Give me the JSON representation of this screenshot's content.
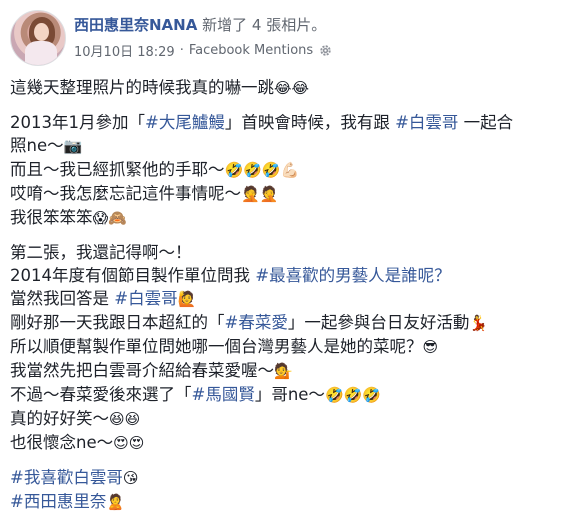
{
  "post": {
    "page_name": "西田惠里奈NANA",
    "action": "新增了 4 張相片。",
    "date": "10月10日 18:29",
    "separator": "·",
    "app": "Facebook Mentions",
    "privacy_icon": "gear-icon"
  },
  "paragraphs": [
    {
      "lines": [
        [
          {
            "t": "這幾天整理照片的時候我真的嚇一跳"
          },
          {
            "t": "😂😂",
            "e": true
          }
        ]
      ]
    },
    {
      "lines": [
        [
          {
            "t": "2013年1月參加「"
          },
          {
            "t": "#大尾鱸鰻",
            "h": true
          },
          {
            "t": "」首映會時候，我有跟 "
          },
          {
            "t": "#白雲哥",
            "h": true
          },
          {
            "t": " 一起合"
          }
        ],
        [
          {
            "t": "照ne～"
          },
          {
            "t": "📷",
            "e": true
          }
        ],
        [
          {
            "t": "而且～我已經抓緊他的手耶～"
          },
          {
            "t": "🤣🤣🤣💪🏻",
            "e": true
          }
        ],
        [
          {
            "t": "哎唷～我怎麼忘記這件事情呢～"
          },
          {
            "t": "🤦🤦",
            "e": true
          }
        ],
        [
          {
            "t": "我很笨笨笨"
          },
          {
            "t": "😱🙈",
            "e": true
          }
        ]
      ]
    },
    {
      "lines": [
        [
          {
            "t": "第二張，我還記得啊～！"
          }
        ],
        [
          {
            "t": "2014年度有個節目製作單位問我 "
          },
          {
            "t": "#最喜歡的男藝人是誰呢？",
            "h": true
          }
        ],
        [
          {
            "t": "當然我回答是 "
          },
          {
            "t": "#白雲哥",
            "h": true
          },
          {
            "t": "🙋",
            "e": true
          }
        ],
        [
          {
            "t": "剛好那一天我跟日本超紅的「"
          },
          {
            "t": "#春菜愛",
            "h": true
          },
          {
            "t": "」一起參與台日友好活動"
          },
          {
            "t": "💃",
            "e": true
          }
        ],
        [
          {
            "t": "所以順便幫製作單位問她哪一個台灣男藝人是她的菜呢？"
          },
          {
            "t": "😎",
            "e": true
          }
        ],
        [
          {
            "t": "我當然先把白雲哥介紹給春菜愛喔～"
          },
          {
            "t": "💁",
            "e": true
          }
        ],
        [
          {
            "t": "不過～春菜愛後來選了「"
          },
          {
            "t": "#馬國賢",
            "h": true
          },
          {
            "t": "」哥ne～"
          },
          {
            "t": "🤣🤣🤣",
            "e": true
          }
        ],
        [
          {
            "t": "真的好好笑～"
          },
          {
            "t": "😆😆",
            "e": true
          }
        ],
        [
          {
            "t": "也很懷念ne～"
          },
          {
            "t": "😍😍",
            "e": true
          }
        ]
      ]
    },
    {
      "lines": [
        [
          {
            "t": "#我喜歡白雲哥",
            "h": true
          },
          {
            "t": "😘",
            "e": true
          }
        ],
        [
          {
            "t": "#西田惠里奈",
            "h": true
          },
          {
            "t": "🙎",
            "e": true
          }
        ]
      ]
    }
  ]
}
